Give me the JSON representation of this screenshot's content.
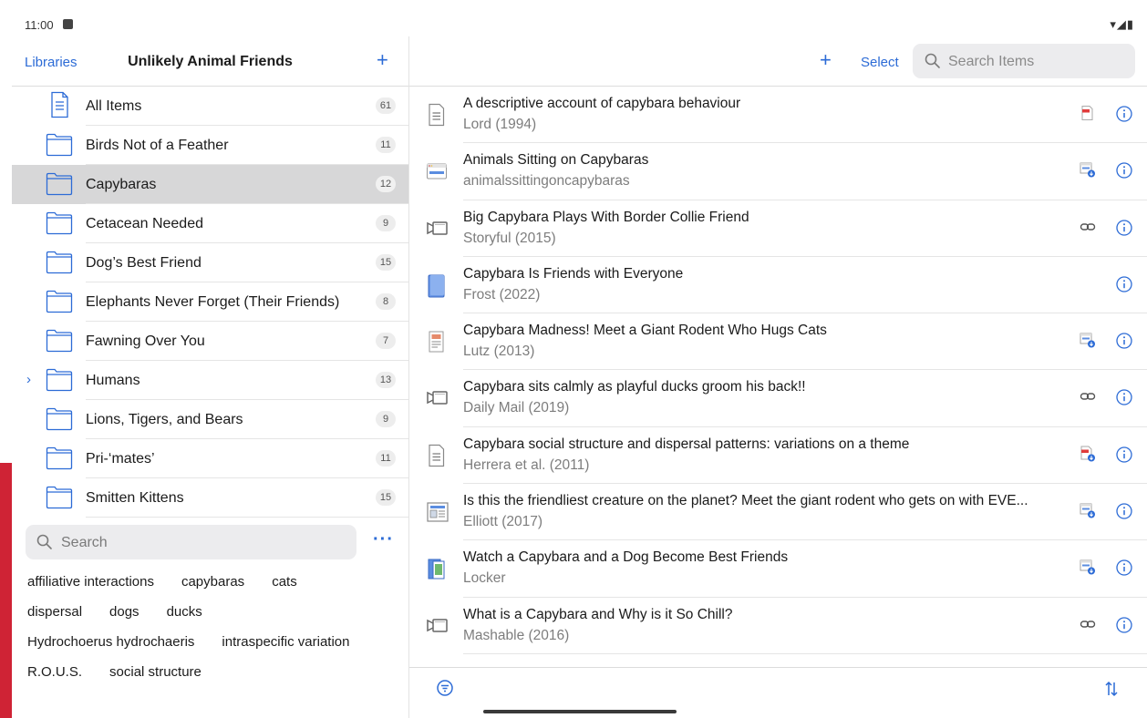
{
  "status_bar": {
    "time": "11:00",
    "system_icons": "▾◢▮"
  },
  "left_pane": {
    "libraries_label": "Libraries",
    "title": "Unlikely Animal Friends",
    "add_label": "+",
    "collections": [
      {
        "label": "All Items",
        "count": "61",
        "icon": "document-icon",
        "selected": false,
        "expandable": false
      },
      {
        "label": "Birds Not of a Feather",
        "count": "11",
        "icon": "folder-icon",
        "selected": false,
        "expandable": false
      },
      {
        "label": "Capybaras",
        "count": "12",
        "icon": "folder-icon",
        "selected": true,
        "expandable": false
      },
      {
        "label": "Cetacean Needed",
        "count": "9",
        "icon": "folder-icon",
        "selected": false,
        "expandable": false
      },
      {
        "label": "Dog’s Best Friend",
        "count": "15",
        "icon": "folder-icon",
        "selected": false,
        "expandable": false
      },
      {
        "label": "Elephants Never Forget (Their Friends)",
        "count": "8",
        "icon": "folder-icon",
        "selected": false,
        "expandable": false
      },
      {
        "label": "Fawning Over You",
        "count": "7",
        "icon": "folder-icon",
        "selected": false,
        "expandable": false
      },
      {
        "label": "Humans",
        "count": "13",
        "icon": "folder-icon",
        "selected": false,
        "expandable": true
      },
      {
        "label": "Lions, Tigers, and Bears",
        "count": "9",
        "icon": "folder-icon",
        "selected": false,
        "expandable": false
      },
      {
        "label": "Pri-‘mates’",
        "count": "11",
        "icon": "folder-icon",
        "selected": false,
        "expandable": false
      },
      {
        "label": "Smitten Kittens",
        "count": "15",
        "icon": "folder-icon",
        "selected": false,
        "expandable": false
      }
    ],
    "tag_search_placeholder": "Search",
    "more_label": "···",
    "tag_lines": [
      [
        "affiliative interactions",
        "capybaras",
        "cats"
      ],
      [
        "dispersal",
        "dogs",
        "ducks"
      ],
      [
        "Hydrochoerus hydrochaeris",
        "intraspecific variation"
      ],
      [
        "R.O.U.S.",
        "social structure"
      ]
    ]
  },
  "right_pane": {
    "add_label": "+",
    "select_label": "Select",
    "search_placeholder": "Search Items",
    "items": [
      {
        "title": "A descriptive account of capybara behaviour",
        "subtitle": "Lord (1994)",
        "type_icon": "journal-article-icon",
        "attachment": "pdf-icon"
      },
      {
        "title": "Animals Sitting on Capybaras",
        "subtitle": "animalssittingoncapybaras",
        "type_icon": "webpage-icon",
        "attachment": "snapshot-download-icon"
      },
      {
        "title": "Big Capybara Plays With Border Collie Friend",
        "subtitle": "Storyful (2015)",
        "type_icon": "video-icon",
        "attachment": "link-icon"
      },
      {
        "title": "Capybara Is Friends with Everyone",
        "subtitle": "Frost (2022)",
        "type_icon": "book-icon",
        "attachment": ""
      },
      {
        "title": "Capybara Madness! Meet a Giant Rodent Who Hugs Cats",
        "subtitle": "Lutz (2013)",
        "type_icon": "magazine-article-icon",
        "attachment": "snapshot-download-icon"
      },
      {
        "title": "Capybara sits calmly as playful ducks groom his back!!",
        "subtitle": "Daily Mail (2019)",
        "type_icon": "video-icon",
        "attachment": "link-icon"
      },
      {
        "title": "Capybara social structure and dispersal patterns: variations on a theme",
        "subtitle": "Herrera et al. (2011)",
        "type_icon": "journal-article-icon",
        "attachment": "pdf-download-icon"
      },
      {
        "title": "Is this the friendliest creature on the planet? Meet the giant rodent who gets on with EVE...",
        "subtitle": "Elliott (2017)",
        "type_icon": "newspaper-article-icon",
        "attachment": "snapshot-download-icon"
      },
      {
        "title": "Watch a Capybara and a Dog Become Best Friends",
        "subtitle": "Locker",
        "type_icon": "blog-post-icon",
        "attachment": "snapshot-download-icon"
      },
      {
        "title": "What is a Capybara and Why is it So Chill?",
        "subtitle": "Mashable (2016)",
        "type_icon": "video-icon",
        "attachment": "link-icon"
      }
    ]
  },
  "colors": {
    "accent": "#2c6bd6",
    "selected_row": "#d7d7d8",
    "side_strip": "#cf2335"
  }
}
